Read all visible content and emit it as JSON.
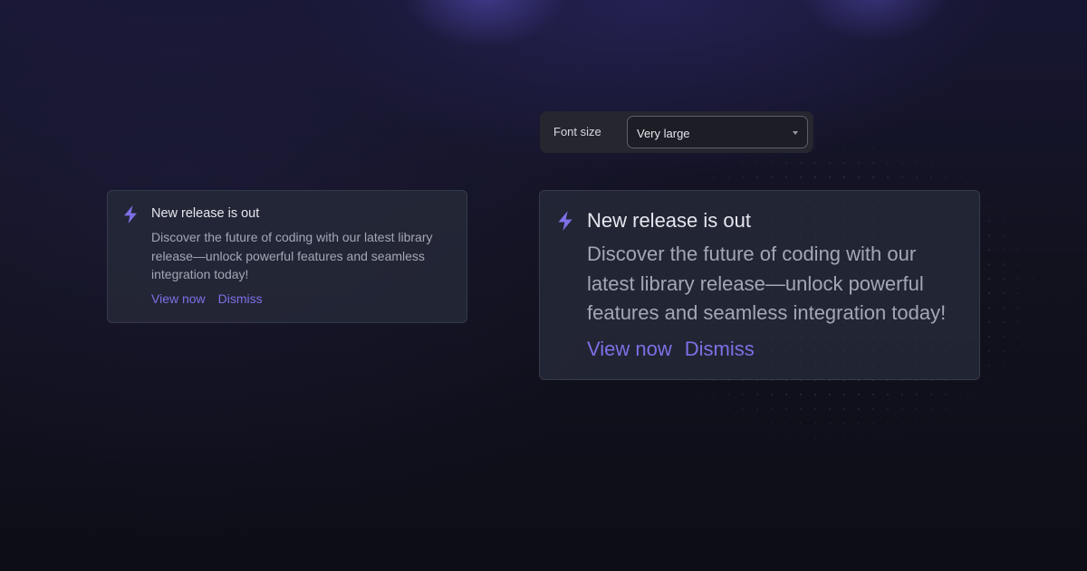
{
  "colors": {
    "accent": "#7c70e6",
    "card_background": "#262a38",
    "card_border": "#353a4a",
    "page_background": "#0d0e17",
    "title_text": "#e6e7ee",
    "description_text": "#a3a7b6"
  },
  "font_size_control": {
    "label": "Font size",
    "selected": "Very large"
  },
  "callouts": [
    {
      "icon": "lightning-bolt-icon",
      "title": "New release is out",
      "description": "Discover the future of coding with our latest library release—unlock powerful features and seamless integration today!",
      "primary_action": "View now",
      "secondary_action": "Dismiss"
    },
    {
      "icon": "lightning-bolt-icon",
      "title": "New release is out",
      "description": "Discover the future of coding with our latest library release—unlock powerful features and seamless integration today!",
      "primary_action": "View now",
      "secondary_action": "Dismiss"
    }
  ]
}
